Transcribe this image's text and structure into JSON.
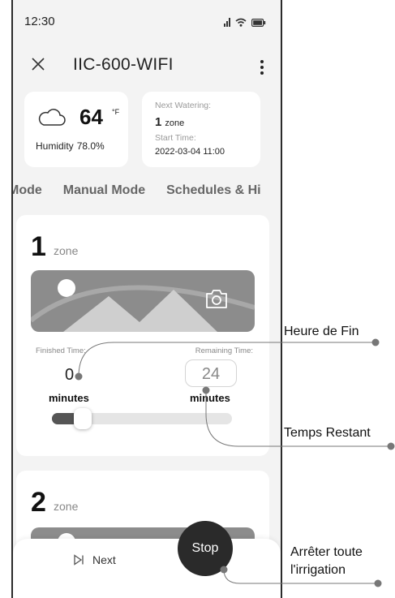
{
  "status_bar": {
    "time": "12:30"
  },
  "header": {
    "title": "IIC-600-WIFI"
  },
  "weather": {
    "temperature": "64",
    "unit": "°F",
    "humidity_label": "Humidity",
    "humidity_value": "78.0%"
  },
  "next_watering": {
    "label": "Next Watering:",
    "zone_number": "1",
    "zone_word": "zone",
    "start_label": "Start Time:",
    "start_time": "2022-03-04 11:00"
  },
  "tabs": [
    "Mode",
    "Manual Mode",
    "Schedules & Hi"
  ],
  "zone1": {
    "number": "1",
    "word": "zone",
    "finished_label": "Finished Time:",
    "finished_value": "0",
    "finished_unit": "minutes",
    "remaining_label": "Remaining Time:",
    "remaining_value": "24",
    "remaining_unit": "minutes",
    "slider_fraction": 0.13
  },
  "zone2": {
    "number": "2",
    "word": "zone"
  },
  "bottom": {
    "next_label": "Next",
    "stop_label": "Stop"
  },
  "annotations": {
    "end_time": "Heure de Fin",
    "remaining_time": "Temps Restant",
    "stop_all_line1": "Arrêter toute",
    "stop_all_line2": "l'irrigation"
  },
  "colors": {
    "stop_button": "#2a2a2a",
    "image_placeholder": "#8c8c8c",
    "background": "#f3f3f3"
  }
}
